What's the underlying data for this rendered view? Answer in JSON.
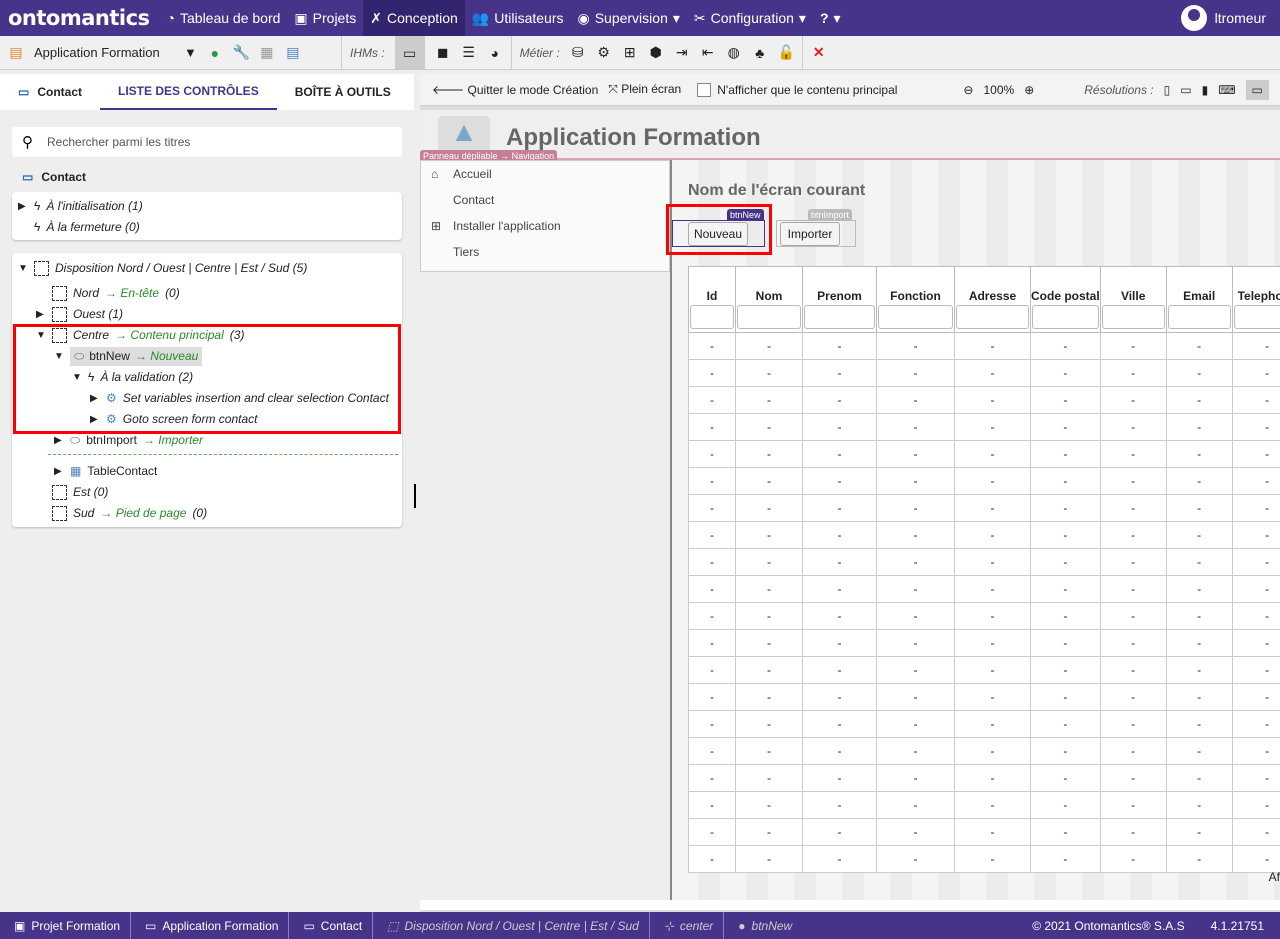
{
  "topbar": {
    "logo": "ontomantics",
    "nav": [
      {
        "label": "Tableau de bord",
        "icon": "dashboard-icon"
      },
      {
        "label": "Projets",
        "icon": "briefcase-icon"
      },
      {
        "label": "Conception",
        "icon": "tools-icon",
        "active": true
      },
      {
        "label": "Utilisateurs",
        "icon": "users-icon"
      },
      {
        "label": "Supervision",
        "icon": "eye-icon",
        "dropdown": true
      },
      {
        "label": "Configuration",
        "icon": "wrench-icon",
        "dropdown": true
      },
      {
        "label": "?",
        "dropdown": true
      }
    ],
    "user": "ltromeur"
  },
  "toolbar": {
    "app_select": "Application Formation",
    "ihms_label": "IHMs :",
    "metier_label": "Métier :"
  },
  "left": {
    "breadcrumb": "Contact",
    "tabs": [
      "LISTE DES CONTRÔLES",
      "BOÎTE À OUTILS"
    ],
    "search_placeholder": "Rechercher parmi les titres",
    "screen_title": "Contact",
    "events": [
      "À l'initialisation (1)",
      "À la fermeture (0)"
    ],
    "tree": {
      "layout": "Disposition Nord / Ouest | Centre | Est / Sud (5)",
      "nord": "Nord",
      "nord_g": "En-tête",
      "nord_c": "(0)",
      "ouest": "Ouest (1)",
      "centre": "Centre",
      "centre_g": "Contenu principal",
      "centre_c": "(3)",
      "btnnew": "btnNew",
      "btnnew_g": "Nouveau",
      "validation": "À la validation (2)",
      "action1": "Set variables insertion and clear selection Contact",
      "action2": "Goto screen form contact",
      "btnimport": "btnImport",
      "btnimport_g": "Importer",
      "table": "TableContact",
      "est": "Est (0)",
      "sud": "Sud",
      "sud_g": "Pied de page",
      "sud_c": "(0)"
    }
  },
  "center": {
    "quit": "Quitter le mode Création",
    "fullscreen": "Plein écran",
    "only_main": "N'afficher que le contenu principal",
    "zoom": "100%",
    "resolutions": "Résolutions :",
    "app_title": "Application Formation",
    "nav_tag": "Panneau dépliable → Navigation",
    "nav_items": [
      "Accueil",
      "Contact",
      "Installer l'application",
      "Tiers"
    ],
    "screen_name": "Nom de l'écran courant",
    "btn_new_tag": "btnNew",
    "btn_new": "Nouveau",
    "btn_import_tag": "btnImport",
    "btn_import": "Importer",
    "columns": [
      "Id",
      "Nom",
      "Prenom",
      "Fonction",
      "Adresse",
      "Code postal",
      "Ville",
      "Email",
      "Telephone"
    ],
    "empty_cell": "-",
    "footer_text": "Af"
  },
  "bottom": {
    "crumbs": [
      "Projet Formation",
      "Application Formation",
      "Contact",
      "Disposition Nord / Ouest | Centre | Est / Sud",
      "center",
      "btnNew"
    ],
    "copyright": "© 2021 Ontomantics® S.A.S",
    "version": "4.1.21751"
  }
}
